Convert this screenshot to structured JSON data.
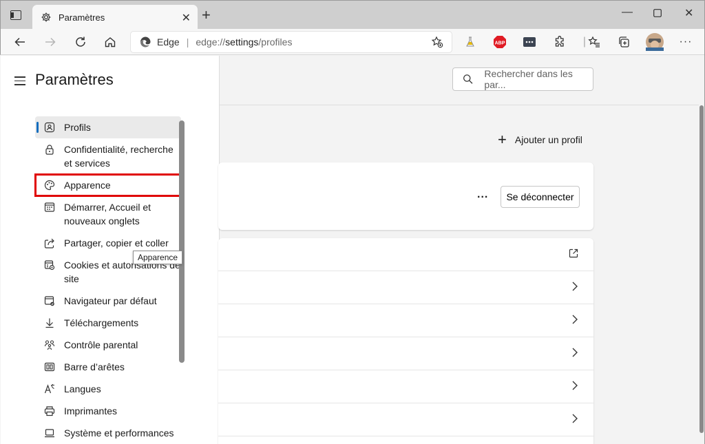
{
  "browser": {
    "tab_title": "Paramètres",
    "site_name": "Edge",
    "url_scheme": "edge://",
    "url_host": "settings",
    "url_path": "/profiles",
    "icons": [
      "sidebar-icon",
      "gear-icon",
      "close-icon",
      "plus-icon",
      "minimize-icon",
      "maximize-icon",
      "close-window-icon",
      "back-icon",
      "forward-icon",
      "refresh-icon",
      "home-icon",
      "favorite-add-icon",
      "extension-flask-icon",
      "adblock-icon",
      "extension-box-icon",
      "extensions-icon",
      "favorites-icon",
      "collections-icon",
      "avatar",
      "more-icon"
    ]
  },
  "settings": {
    "title": "Paramètres",
    "search_placeholder": "Rechercher dans les par...",
    "nav": [
      {
        "label": "Profils",
        "icon": "profile-icon"
      },
      {
        "label": "Confidentialité, recherche et services",
        "icon": "lock-icon"
      },
      {
        "label": "Apparence",
        "icon": "palette-icon"
      },
      {
        "label": "Démarrer, Accueil et nouveaux onglets",
        "icon": "start-icon"
      },
      {
        "label": "Partager, copier et coller",
        "icon": "share-icon"
      },
      {
        "label": "Cookies et autorisations de site",
        "icon": "cookies-icon"
      },
      {
        "label": "Navigateur par défaut",
        "icon": "browser-icon"
      },
      {
        "label": "Téléchargements",
        "icon": "download-icon"
      },
      {
        "label": "Contrôle parental",
        "icon": "family-icon"
      },
      {
        "label": "Barre d’arêtes",
        "icon": "edge-bar-icon"
      },
      {
        "label": "Langues",
        "icon": "languages-icon"
      },
      {
        "label": "Imprimantes",
        "icon": "printer-icon"
      },
      {
        "label": "Système et performances",
        "icon": "system-icon"
      }
    ],
    "tooltip": "Apparence"
  },
  "content": {
    "add_profile": "Ajouter un profil",
    "more": "...",
    "sign_out": "Se déconnecter"
  },
  "colors": {
    "accent": "#0f6cbd",
    "highlight": "#e00000"
  }
}
